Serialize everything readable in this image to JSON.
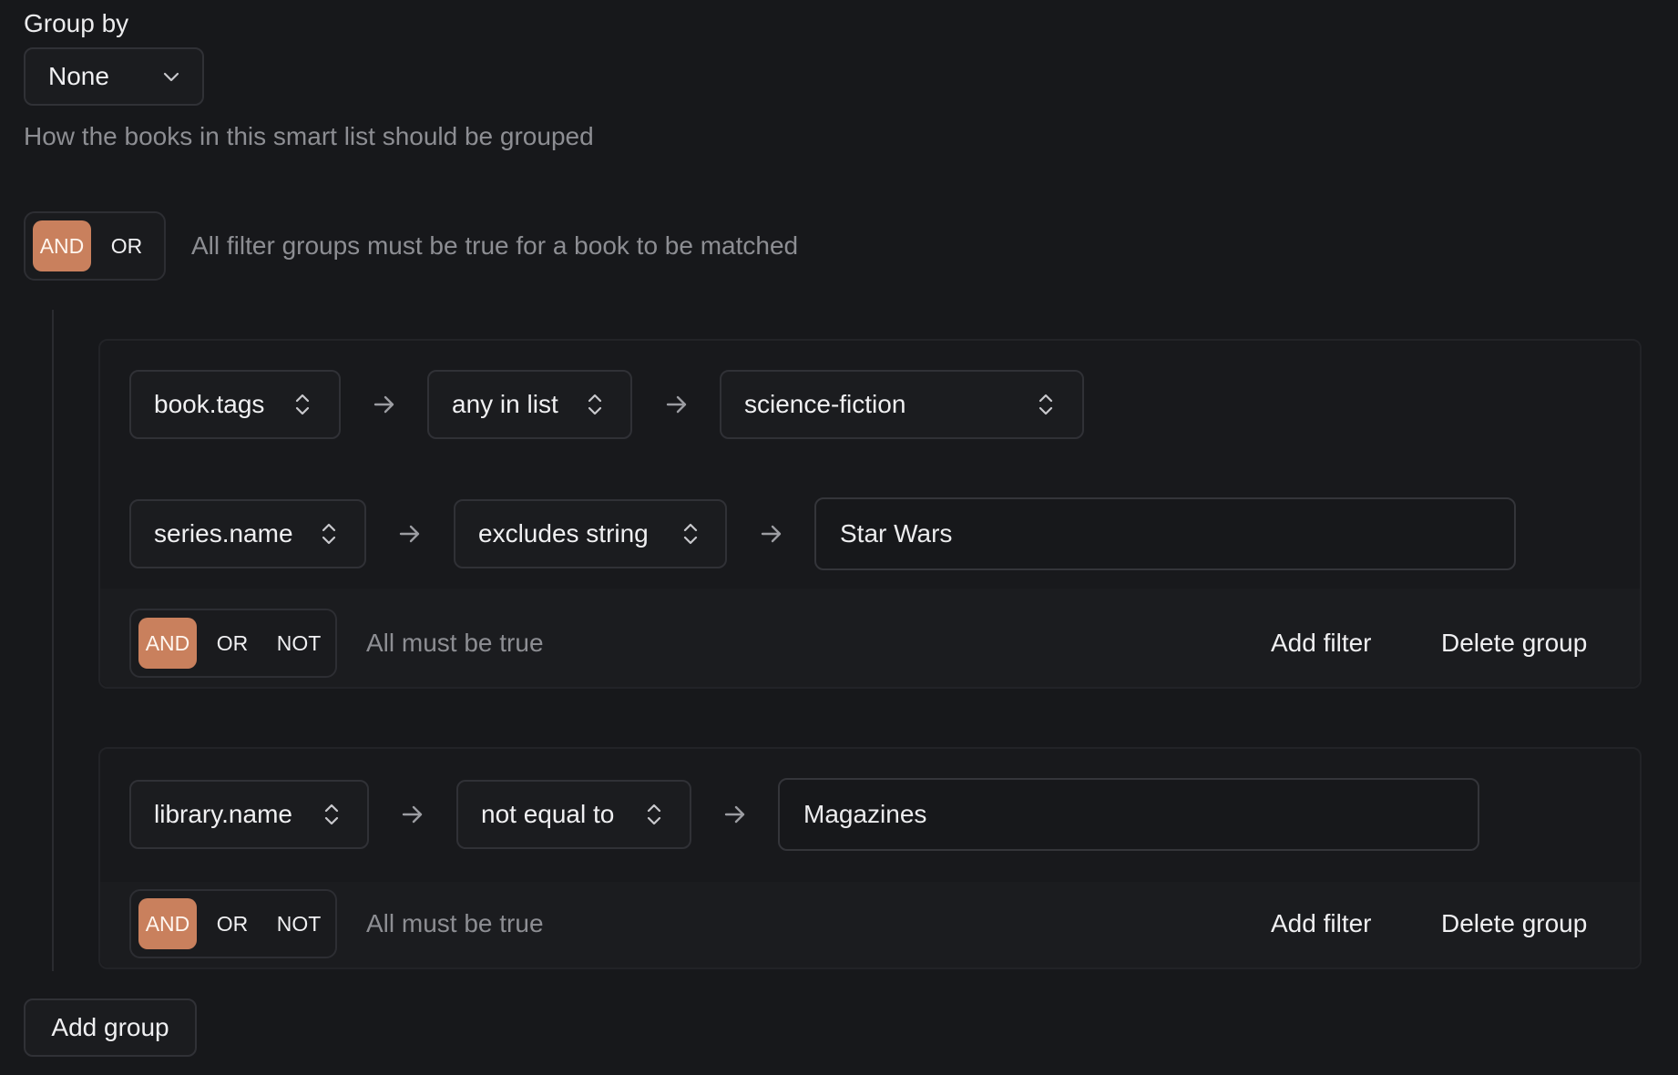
{
  "group_by": {
    "label": "Group by",
    "selected": "None",
    "help": "How the books in this smart list should be grouped"
  },
  "root": {
    "ops": [
      "AND",
      "OR"
    ],
    "active": "AND",
    "description": "All filter groups must be true for a book to be matched"
  },
  "groups": [
    {
      "filters": [
        {
          "field": "book.tags",
          "operator": "any in list",
          "value": "science-fiction"
        },
        {
          "field": "series.name",
          "operator": "excludes string",
          "value": "Star Wars"
        }
      ],
      "ops": [
        "AND",
        "OR",
        "NOT"
      ],
      "active": "AND",
      "description": "All must be true",
      "add_filter": "Add filter",
      "delete_group": "Delete group"
    },
    {
      "filters": [
        {
          "field": "library.name",
          "operator": "not equal to",
          "value": "Magazines"
        }
      ],
      "ops": [
        "AND",
        "OR",
        "NOT"
      ],
      "active": "AND",
      "description": "All must be true",
      "add_filter": "Add filter",
      "delete_group": "Delete group"
    }
  ],
  "add_group": "Add group",
  "colors": {
    "background": "#17181b",
    "accent": "#c9805d"
  }
}
